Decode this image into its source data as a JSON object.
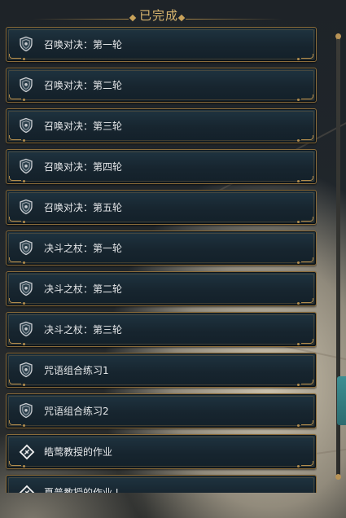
{
  "header": {
    "title": "已完成"
  },
  "quests": [
    {
      "label": "召唤对决：第一轮",
      "icon": "shield-icon"
    },
    {
      "label": "召唤对决：第二轮",
      "icon": "shield-icon"
    },
    {
      "label": "召唤对决：第三轮",
      "icon": "shield-icon"
    },
    {
      "label": "召唤对决：第四轮",
      "icon": "shield-icon"
    },
    {
      "label": "召唤对决：第五轮",
      "icon": "shield-icon"
    },
    {
      "label": "决斗之杖：第一轮",
      "icon": "shield-icon"
    },
    {
      "label": "决斗之杖：第二轮",
      "icon": "shield-icon"
    },
    {
      "label": "决斗之杖：第三轮",
      "icon": "shield-icon"
    },
    {
      "label": "咒语组合练习1",
      "icon": "shield-icon"
    },
    {
      "label": "咒语组合练习2",
      "icon": "shield-icon"
    },
    {
      "label": "皓莺教授的作业",
      "icon": "assignment-icon"
    },
    {
      "label": "夏普教授的作业 I",
      "icon": "assignment-icon"
    }
  ],
  "colors": {
    "accent_gold": "#c9a25a",
    "card_bg": "#1a2a35",
    "text": "#e6e8ea",
    "side_tab": "#3e8f93"
  }
}
